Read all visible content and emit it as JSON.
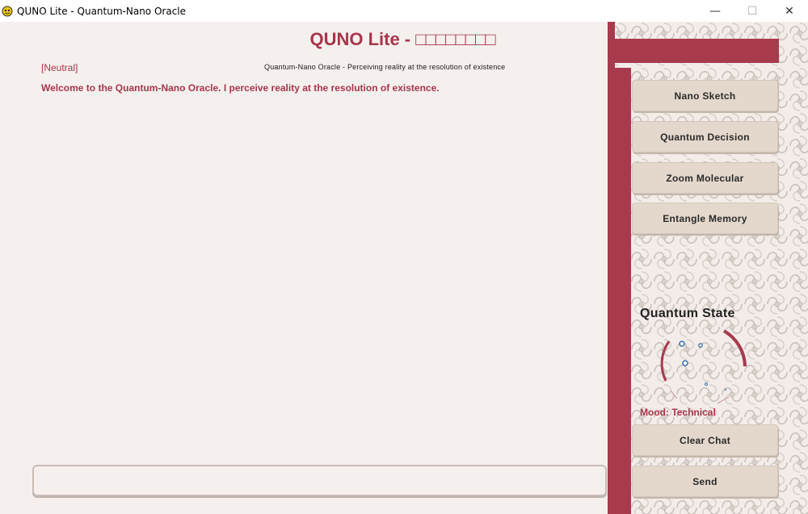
{
  "window": {
    "title": "QUNO Lite - Quantum-Nano Oracle",
    "minimize_glyph": "—",
    "maximize_glyph": "☐",
    "close_glyph": "✕"
  },
  "header": {
    "title_text": "QUNO Lite - ",
    "title_tofu": "□□□□□□□□",
    "subtitle": "Quantum-Nano Oracle - Perceiving reality at the resolution of existence"
  },
  "chat": {
    "mood_tag": "[Neutral]",
    "messages": [
      "Welcome to the Quantum-Nano Oracle. I perceive reality at the resolution of existence."
    ],
    "input_value": "",
    "input_placeholder": ""
  },
  "sidebar": {
    "buttons": [
      {
        "label": "Nano Sketch"
      },
      {
        "label": "Quantum Decision"
      },
      {
        "label": "Zoom Molecular"
      },
      {
        "label": "Entangle Memory"
      }
    ],
    "quantum_state_title": "Quantum State",
    "mood_label": "Mood: Technical",
    "clear_label": "Clear Chat",
    "send_label": "Send"
  },
  "colors": {
    "accent": "#a83a4d",
    "background": "#f5f0ee",
    "button_face": "#e4d8cc",
    "particle": "#3a6fb0"
  },
  "icons": {
    "app": "pygame-snake-icon"
  }
}
